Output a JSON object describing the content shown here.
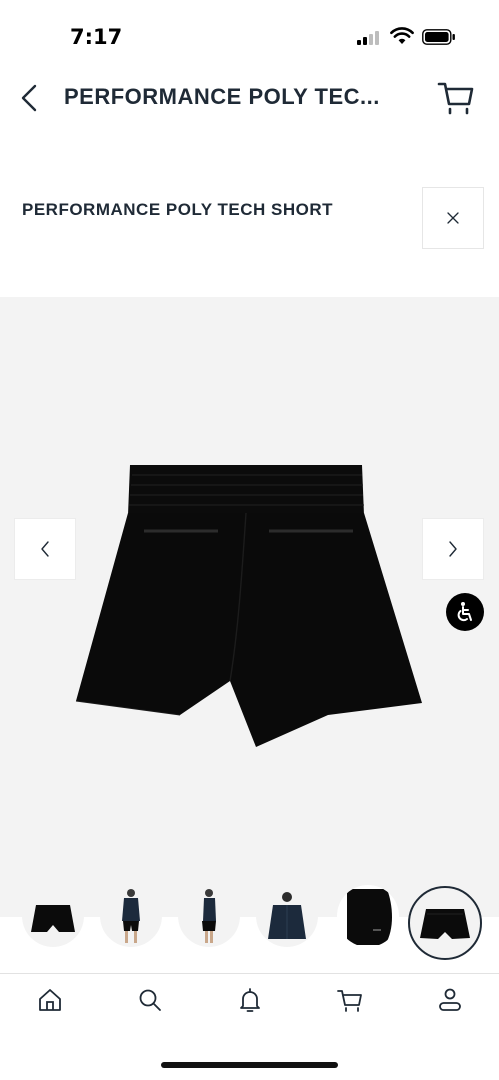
{
  "status_bar": {
    "time": "7:17"
  },
  "header": {
    "title": "PERFORMANCE POLY TEC...",
    "back_icon": "chevron-left-icon",
    "cart_icon": "cart-icon"
  },
  "product": {
    "name": "PERFORMANCE POLY TECH SHORT",
    "close_icon": "close-icon"
  },
  "gallery": {
    "prev_icon": "chevron-left-icon",
    "next_icon": "chevron-right-icon",
    "accessibility_icon": "wheelchair-icon",
    "thumbnails": [
      {
        "id": "shorts-front"
      },
      {
        "id": "model-front"
      },
      {
        "id": "model-side"
      },
      {
        "id": "model-back"
      },
      {
        "id": "fabric-closeup"
      },
      {
        "id": "shorts-back",
        "selected": true
      }
    ]
  },
  "tab_bar": {
    "tabs": [
      {
        "icon": "home-icon"
      },
      {
        "icon": "search-icon"
      },
      {
        "icon": "bell-icon"
      },
      {
        "icon": "cart-icon"
      },
      {
        "icon": "profile-icon"
      }
    ]
  },
  "colors": {
    "text": "#1f2a36",
    "gallery_bg": "#f3f3f3",
    "product": "#0a0a0a"
  }
}
